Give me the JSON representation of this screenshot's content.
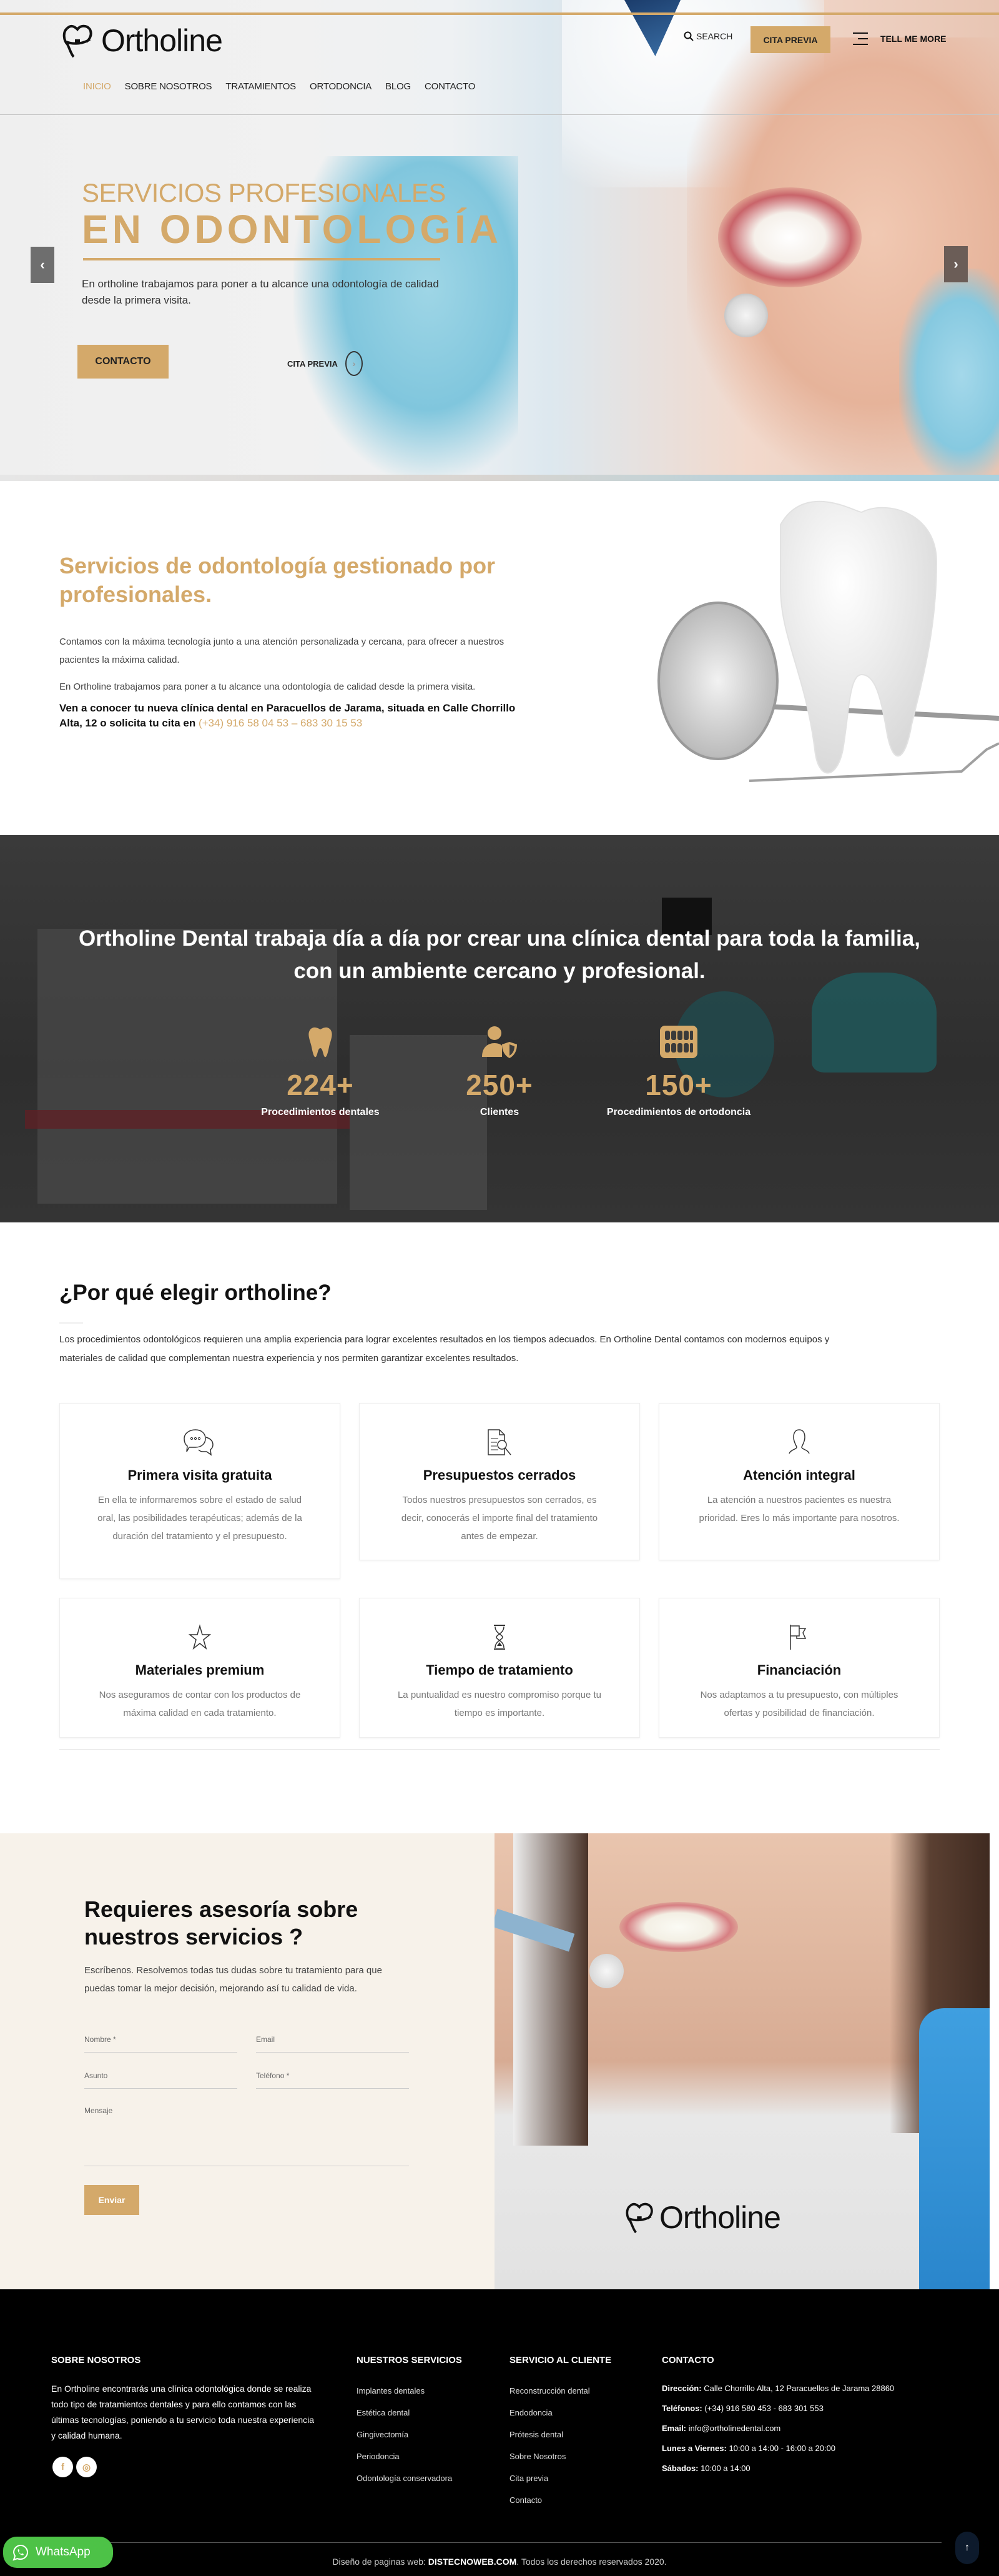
{
  "brand": {
    "name": "Ortholine",
    "mark": "E.A"
  },
  "colors": {
    "accent": "#d4a96a",
    "dark": "#000000",
    "cream": "#f7f2ea",
    "whatsapp": "#4dc247"
  },
  "header": {
    "nav": [
      {
        "label": "INICIO",
        "active": true
      },
      {
        "label": "SOBRE NOSOTROS"
      },
      {
        "label": "TRATAMIENTOS"
      },
      {
        "label": "ORTODONCIA"
      },
      {
        "label": "BLOG"
      },
      {
        "label": "CONTACTO"
      }
    ],
    "search_label": "SEARCH",
    "cta_label": "CITA PREVIA",
    "menu_label": "TELL ME MORE"
  },
  "hero": {
    "subtitle": "SERVICIOS PROFESIONALES",
    "title": "EN ODONTOLOGÍA",
    "description": "En ortholine trabajamos para poner a tu alcance una odontología de calidad desde la primera visita.",
    "primary_button": "CONTACTO",
    "secondary_link": "CITA PREVIA",
    "prev_icon": "‹",
    "next_icon": "›"
  },
  "intro": {
    "title": "Servicios de odontología gestionado por profesionales.",
    "paragraphs": [
      "Contamos con la máxima tecnología junto a una atención personalizada y cercana, para ofrecer a nuestros pacientes la máxima calidad.",
      "En Ortholine trabajamos para poner a tu alcance una odontología de calidad desde la primera visita."
    ],
    "highlight": "Ven a conocer tu nueva clínica dental en Paracuellos de Jarama, situada en Calle Chorrillo Alta, 12 o solicita tu cita en ",
    "phones": "(+34) 916 58 04 53 – 683 30 15 53"
  },
  "stats": {
    "title": "Ortholine Dental trabaja día a día por crear una clínica dental para toda la familia, con un ambiente cercano y profesional.",
    "items": [
      {
        "icon": "tooth-icon",
        "value": "224+",
        "label": "Procedimientos dentales"
      },
      {
        "icon": "user-shield-icon",
        "value": "250+",
        "label": "Clientes"
      },
      {
        "icon": "teeth-icon",
        "value": "150+",
        "label": "Procedimientos de ortodoncia"
      }
    ]
  },
  "why": {
    "title": "¿Por qué elegir ortholine?",
    "description": "Los procedimientos odontológicos requieren una amplia experiencia para lograr excelentes resultados en los tiempos adecuados. En Ortholine Dental contamos con modernos equipos y materiales de calidad que complementan nuestra experiencia y nos permiten garantizar excelentes resultados.",
    "cards": [
      {
        "icon": "chat-bubbles-icon",
        "title": "Primera visita gratuita",
        "text": "En ella te informaremos sobre el estado de salud oral, las posibilidades terapéuticas; además de la duración del tratamiento y el presupuesto."
      },
      {
        "icon": "document-search-icon",
        "title": "Presupuestos cerrados",
        "text": "Todos nuestros presupuestos son cerrados, es decir, conocerás el importe final del tratamiento antes de empezar."
      },
      {
        "icon": "user-icon",
        "title": "Atención integral",
        "text": "La atención a nuestros pacientes es nuestra prioridad. Eres lo más importante para nosotros."
      },
      {
        "icon": "star-icon",
        "title": "Materiales premium",
        "text": "Nos aseguramos de contar con los productos de máxima calidad en cada tratamiento."
      },
      {
        "icon": "hourglass-icon",
        "title": "Tiempo de tratamiento",
        "text": "La puntualidad es nuestro compromiso porque tu tiempo es importante."
      },
      {
        "icon": "flag-icon",
        "title": "Financiación",
        "text": "Nos adaptamos a tu presupuesto, con múltiples ofertas y posibilidad de financiación."
      }
    ]
  },
  "contact_form": {
    "title": "Requieres asesoría sobre nuestros servicios ?",
    "description": "Escríbenos. Resolvemos todas tus dudas sobre tu tratamiento para que puedas tomar la mejor decisión, mejorando así tu calidad de vida.",
    "fields": {
      "name": {
        "placeholder": "Nombre *",
        "value": ""
      },
      "email": {
        "placeholder": "Email",
        "value": ""
      },
      "subject": {
        "placeholder": "Asunto",
        "value": ""
      },
      "phone": {
        "placeholder": "Teléfono *",
        "value": ""
      },
      "message": {
        "placeholder": "Mensaje",
        "value": ""
      }
    },
    "submit_label": "Enviar"
  },
  "footer": {
    "about": {
      "heading": "SOBRE NOSOTROS",
      "text": "En Ortholine encontrarás una clínica odontológica donde se realiza todo tipo de tratamientos dentales y para ello contamos con las últimas tecnologías, poniendo a tu servicio toda nuestra experiencia y calidad humana.",
      "social": [
        {
          "icon": "facebook-icon",
          "glyph": "f"
        },
        {
          "icon": "instagram-icon",
          "glyph": "◎"
        }
      ]
    },
    "services": {
      "heading": "NUESTROS SERVICIOS",
      "items": [
        "Implantes dentales",
        "Estética dental",
        "Gingivectomía",
        "Periodoncia",
        "Odontología conservadora"
      ]
    },
    "customer": {
      "heading": "SERVICIO AL CLIENTE",
      "items": [
        "Reconstrucción dental",
        "Endodoncia",
        "Prótesis dental",
        "Sobre Nosotros",
        "Cita previa",
        "Contacto"
      ]
    },
    "contact": {
      "heading": "CONTACTO",
      "items": [
        {
          "label": "Dirección:",
          "value": "Calle Chorrillo Alta, 12 Paracuellos de Jarama 28860"
        },
        {
          "label": "Teléfonos:",
          "value": "(+34) 916 580 453 - 683 301 553"
        },
        {
          "label": "Email:",
          "value": "info@ortholinedental.com"
        },
        {
          "label": "Lunes a Viernes:",
          "value": "10:00 a 14:00 - 16:00 a 20:00"
        },
        {
          "label": "Sábados:",
          "value": "10:00 a 14:00"
        }
      ]
    },
    "copyright": {
      "prefix": "Diseño de paginas web: ",
      "brand": "DISTECNOWEB.COM",
      "suffix": ". Todos los derechos reservados 2020."
    },
    "whatsapp_label": "WhatsApp",
    "to_top_icon": "↑"
  }
}
